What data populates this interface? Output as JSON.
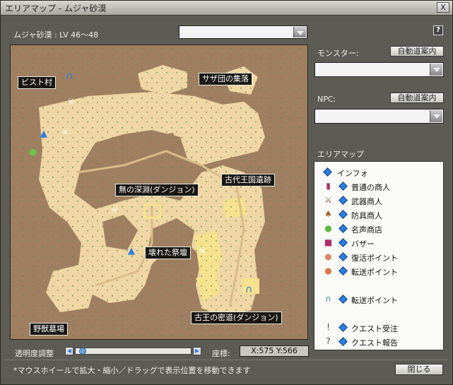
{
  "window": {
    "title": "エリアマップ - ムジャ砂漠",
    "close_label": "X",
    "help_label": "?"
  },
  "area": {
    "name_level": "ムジャ砂漠 : LV 46～48",
    "selector_value": ""
  },
  "monster": {
    "label": "モンスター:",
    "auto_button": "自動道案内",
    "selected": ""
  },
  "npc": {
    "label": "NPC:",
    "auto_button": "自動道案内",
    "selected": ""
  },
  "map": {
    "labels": {
      "bist": "ビスト村",
      "sazadan": "サザ団の集落",
      "kodai": "古代王国遺跡",
      "mu": "無の深淵(ダンジョン)",
      "kowareta": "壊れた祭壇",
      "koou": "古王の密道(ダンジョン)",
      "yajuu": "野獣墓場"
    }
  },
  "legend": {
    "title": "エリアマップ",
    "items": [
      {
        "icon": "info-icon",
        "label": "インフォ"
      },
      {
        "icon": "general-merchant-icon",
        "label": "普通の商人"
      },
      {
        "icon": "weapon-merchant-icon",
        "label": "武器商人"
      },
      {
        "icon": "armor-merchant-icon",
        "label": "防具商人"
      },
      {
        "icon": "fame-shop-icon",
        "label": "名声商店"
      },
      {
        "icon": "bazaar-icon",
        "label": "バザー"
      },
      {
        "icon": "revive-point-icon",
        "label": "復活ポイント"
      },
      {
        "icon": "teleport-npc-icon",
        "label": "転送ポイント"
      },
      {
        "icon": "teleport-gate-icon",
        "label": "転送ポイント"
      },
      {
        "icon": "quest-accept-icon",
        "label": "クエスト受注"
      },
      {
        "icon": "quest-report-icon",
        "label": "クエスト報告"
      }
    ]
  },
  "transparency": {
    "label": "透明度調整",
    "value_percent": 3
  },
  "coordinates": {
    "label": "座標:",
    "value": "X:575 Y:566"
  },
  "footer": {
    "hint": "*マウスホイールで拡大・縮小／ドラッグで表示位置を移動できます",
    "close_button": "閉じる"
  },
  "colors": {
    "map_ground": "#a07e62",
    "sand": "#efd6a4",
    "legend_diamond": "#2c7ee0",
    "label_bg": "#191712"
  }
}
